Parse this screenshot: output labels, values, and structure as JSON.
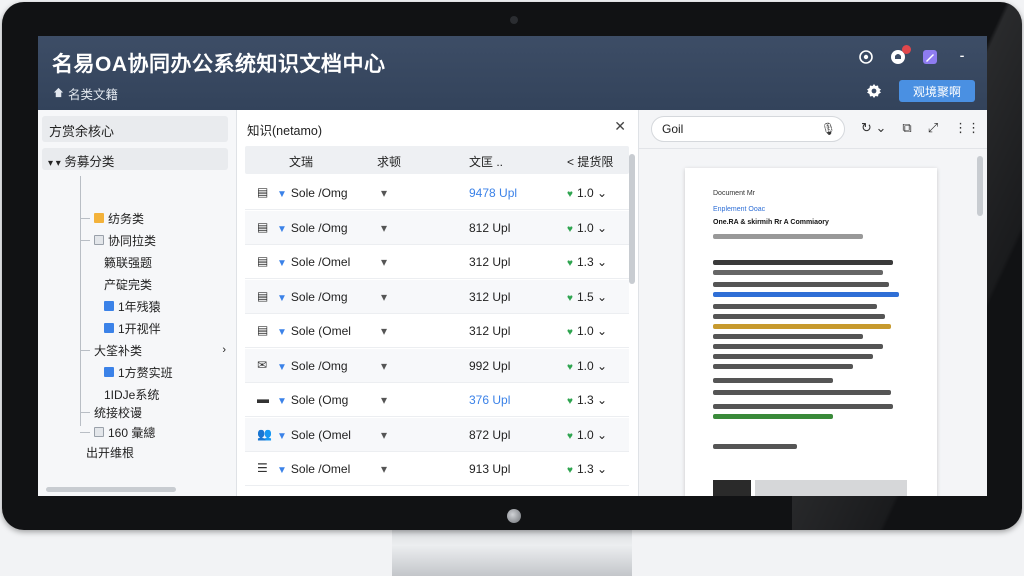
{
  "header": {
    "title": "名易OA协同办公系统知识文档中心",
    "breadcrumb": "名类文籍",
    "action_button": "观境聚啊",
    "colors": {
      "bg": "#3d4d66",
      "button": "#4a90e2",
      "badge": "#e0474c"
    }
  },
  "left": {
    "title": "方赏余核心",
    "root": "务募分类",
    "items": [
      {
        "label": "纺务类"
      },
      {
        "label": "协同拉类"
      },
      {
        "label": "籁联强题"
      },
      {
        "label": "产碇完类"
      },
      {
        "label": "1年残猿"
      },
      {
        "label": "1开视伴"
      },
      {
        "label": "大筌补类"
      },
      {
        "label": "1方赘实班"
      },
      {
        "label": "1IDJe系统"
      },
      {
        "label": "统接校谩"
      },
      {
        "label": "160 彙總"
      },
      {
        "label": "出开维根"
      }
    ]
  },
  "middle": {
    "title": "知识(netamo)",
    "columns": [
      "文瑞",
      "求顿",
      "文匡 ..",
      "< 提货限"
    ],
    "rows": [
      {
        "icon": "doc-icon",
        "name": "Sole /Omg",
        "size": "9478 Upl",
        "size_highlight": true,
        "rating": "1.0 ⌄"
      },
      {
        "icon": "doc-icon",
        "name": "Sole /Omg",
        "size": "812 Upl",
        "size_highlight": false,
        "rating": "1.0 ⌄"
      },
      {
        "icon": "doc-icon",
        "name": "Sole /Omel",
        "size": "312 Upl",
        "size_highlight": false,
        "rating": "1.3 ⌄"
      },
      {
        "icon": "doc-icon",
        "name": "Sole /Omg",
        "size": "312 Upl",
        "size_highlight": false,
        "rating": "1.5 ⌄"
      },
      {
        "icon": "doc-icon",
        "name": "Sole (Omel",
        "size": "312 Upl",
        "size_highlight": false,
        "rating": "1.0 ⌄"
      },
      {
        "icon": "mail-icon",
        "name": "Sole /Omg",
        "size": "992 Upl",
        "size_highlight": false,
        "rating": "1.0 ⌄"
      },
      {
        "icon": "folder-icon",
        "name": "Sole (Omg",
        "size": "376 Upl",
        "size_highlight": true,
        "rating": "1.3 ⌄"
      },
      {
        "icon": "users-icon",
        "name": "Sole (Omel",
        "size": "872 Upl",
        "size_highlight": false,
        "rating": "1.0 ⌄"
      },
      {
        "icon": "list-icon",
        "name": "Sole /Omel",
        "size": "913 Upl",
        "size_highlight": false,
        "rating": "1.3 ⌄"
      }
    ]
  },
  "right": {
    "search_value": "Goil",
    "doc": {
      "line1": "Document Mr",
      "line2": "Enplement Ooac",
      "heading": "One.RA & skirmih Rr A Commiaory"
    }
  }
}
